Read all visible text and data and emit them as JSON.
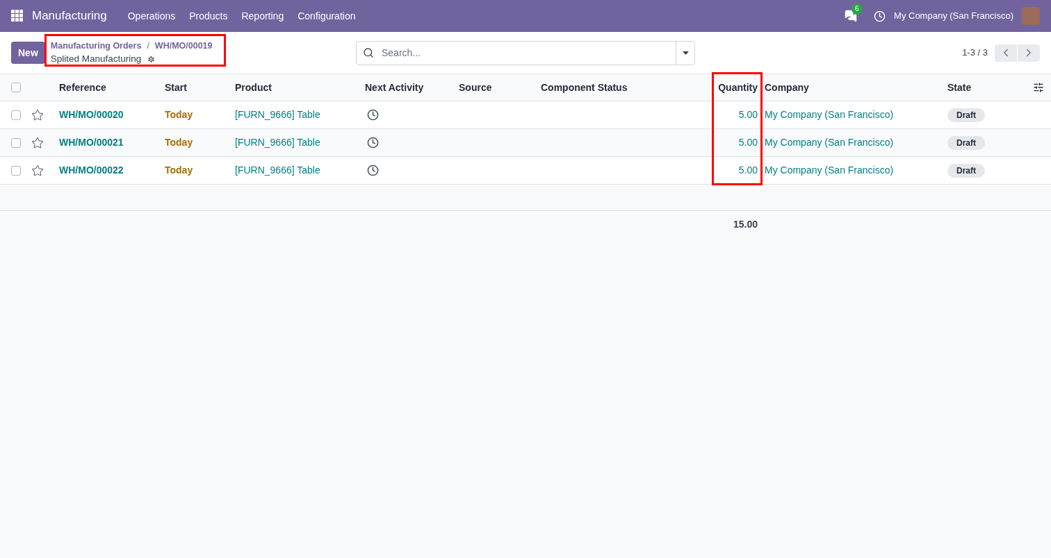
{
  "navbar": {
    "app_name": "Manufacturing",
    "menu": [
      "Operations",
      "Products",
      "Reporting",
      "Configuration"
    ],
    "messages_badge": "6",
    "company": "My Company (San Francisco)"
  },
  "control_panel": {
    "new_button": "New",
    "breadcrumb": [
      "Manufacturing Orders",
      "WH/MO/00019"
    ],
    "breadcrumb_separator": "/",
    "title": "Splited Manufacturing",
    "search": {
      "placeholder": "Search..."
    },
    "pager": "1-3 / 3"
  },
  "table": {
    "select_all_checked": false,
    "columns": [
      "Reference",
      "Start",
      "Product",
      "Next Activity",
      "Source",
      "Component Status",
      "Quantity",
      "Company",
      "State"
    ],
    "rows": [
      {
        "checked": false,
        "starred": false,
        "reference": "WH/MO/00020",
        "start": "Today",
        "product": "[FURN_9666] Table",
        "quantity": "5.00",
        "company": "My Company (San Francisco)",
        "state": "Draft"
      },
      {
        "checked": false,
        "starred": false,
        "reference": "WH/MO/00021",
        "start": "Today",
        "product": "[FURN_9666] Table",
        "quantity": "5.00",
        "company": "My Company (San Francisco)",
        "state": "Draft"
      },
      {
        "checked": false,
        "starred": false,
        "reference": "WH/MO/00022",
        "start": "Today",
        "product": "[FURN_9666] Table",
        "quantity": "5.00",
        "company": "My Company (San Francisco)",
        "state": "Draft"
      }
    ],
    "total_quantity": "15.00"
  }
}
